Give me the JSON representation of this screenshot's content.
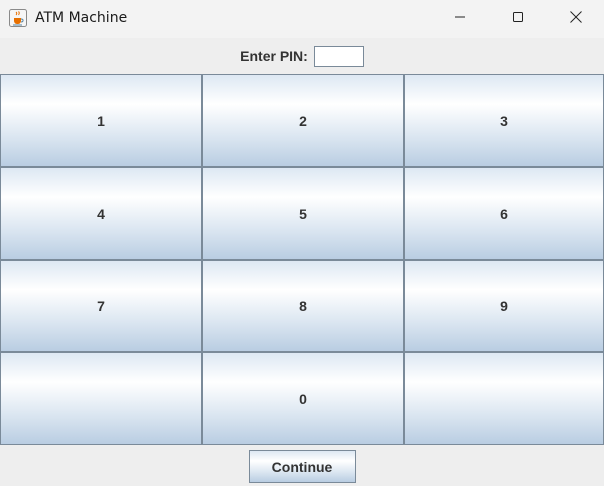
{
  "window": {
    "title": "ATM Machine",
    "app_icon": "java-cup-icon",
    "controls": [
      "minimize-icon",
      "maximize-icon",
      "close-icon"
    ]
  },
  "pin": {
    "label": "Enter PIN:",
    "value": ""
  },
  "keypad": {
    "keys": [
      "1",
      "2",
      "3",
      "4",
      "5",
      "6",
      "7",
      "8",
      "9",
      "",
      "0",
      ""
    ]
  },
  "actions": {
    "continue_label": "Continue"
  },
  "colors": {
    "button_border": "#7a8a99",
    "button_gradient_top": "#dde8f3",
    "button_gradient_bottom": "#b9cde2",
    "window_bg": "#eeeeee",
    "titlebar_bg": "#f3f3f3"
  }
}
